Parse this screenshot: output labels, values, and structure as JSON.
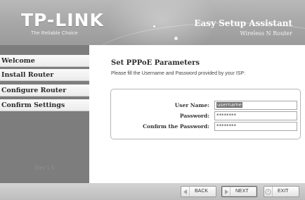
{
  "header": {
    "logo": "TP-LINK",
    "tagline": "The Reliable Choice",
    "title": "Easy Setup Assistant",
    "subtitle": "Wireless N Router"
  },
  "sidebar": {
    "items": [
      {
        "label": "Welcome"
      },
      {
        "label": "Install Router"
      },
      {
        "label": "Configure Router"
      },
      {
        "label": "Confirm Settings"
      }
    ],
    "version": "Rev 1.5"
  },
  "main": {
    "title": "Set PPPoE Parameters",
    "instructions": "Please fill the Username and Password provided by your ISP:",
    "fields": {
      "username": {
        "label": "User Name:",
        "value": "username"
      },
      "password": {
        "label": "Password:",
        "value": "********"
      },
      "confirm": {
        "label": "Confirm the Password:",
        "value": "********"
      }
    }
  },
  "footer": {
    "back": "BACK",
    "next": "NEXT",
    "exit": "EXIT"
  },
  "icons": {
    "back": "triangle-left-icon",
    "next": "triangle-right-icon",
    "exit": "exit-circle-icon"
  }
}
